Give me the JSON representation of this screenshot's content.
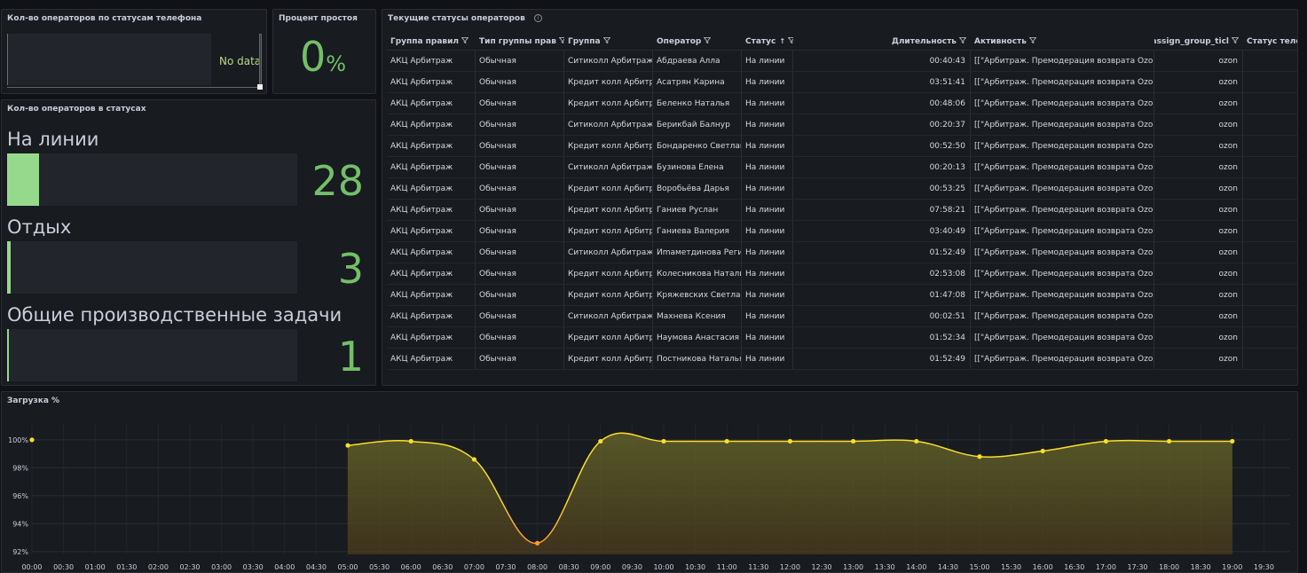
{
  "panels": {
    "phone": {
      "title": "Кол-во операторов по статусам телефона",
      "no_data": "No data"
    },
    "idle": {
      "title": "Процент простоя",
      "value": "0",
      "unit": "%"
    },
    "statuses": {
      "title": "Кол-во операторов в статусах",
      "items": [
        {
          "label": "На линии",
          "value": "28",
          "fill": 0.11
        },
        {
          "label": "Отдых",
          "value": "3",
          "fill": 0.012
        },
        {
          "label": "Общие производственные задачи",
          "value": "1",
          "fill": 0.004
        }
      ]
    },
    "table": {
      "title": "Текущие статусы операторов",
      "columns": [
        "Группа правил",
        "Тип группы прав",
        "Группа",
        "Оператор",
        "Статус",
        "Длительность",
        "Активность",
        "assign_group_ticl",
        "Статус теле"
      ],
      "rows": [
        [
          "АКЦ Арбитраж",
          "Обычная",
          "Ситиколл Арбитраж",
          "Абдраева Алла",
          "На линии",
          "00:40:43",
          "[[\"Арбитраж. Премодерация возврата Ozon",
          "ozon",
          ""
        ],
        [
          "АКЦ Арбитраж",
          "Обычная",
          "Кредит колл Арбитраж",
          "Асатрян Карина",
          "На линии",
          "03:51:41",
          "[[\"Арбитраж. Премодерация возврата Ozon",
          "ozon",
          ""
        ],
        [
          "АКЦ Арбитраж",
          "Обычная",
          "Кредит колл Арбитраж",
          "Беленко Наталья",
          "На линии",
          "00:48:06",
          "[[\"Арбитраж. Премодерация возврата Ozon",
          "ozon",
          ""
        ],
        [
          "АКЦ Арбитраж",
          "Обычная",
          "Ситиколл Арбитраж",
          "Берикбай Балнур",
          "На линии",
          "00:20:37",
          "[[\"Арбитраж. Премодерация возврата Ozon",
          "ozon",
          ""
        ],
        [
          "АКЦ Арбитраж",
          "Обычная",
          "Кредит колл Арбитраж",
          "Бондаренко Светлана",
          "На линии",
          "00:52:50",
          "[[\"Арбитраж. Премодерация возврата Ozon",
          "ozon",
          ""
        ],
        [
          "АКЦ Арбитраж",
          "Обычная",
          "Ситиколл Арбитраж",
          "Бузинова Елена",
          "На линии",
          "00:20:13",
          "[[\"Арбитраж. Премодерация возврата Ozon",
          "ozon",
          ""
        ],
        [
          "АКЦ Арбитраж",
          "Обычная",
          "Кредит колл Арбитраж",
          "Воробьёва Дарья",
          "На линии",
          "00:53:25",
          "[[\"Арбитраж. Премодерация возврата Ozon",
          "ozon",
          ""
        ],
        [
          "АКЦ Арбитраж",
          "Обычная",
          "Кредит колл Арбитраж",
          "Ганиев Руслан",
          "На линии",
          "07:58:21",
          "[[\"Арбитраж. Премодерация возврата Ozon",
          "ozon",
          ""
        ],
        [
          "АКЦ Арбитраж",
          "Обычная",
          "Кредит колл Арбитраж",
          "Ганиева Валерия",
          "На линии",
          "03:40:49",
          "[[\"Арбитраж. Премодерация возврата Ozon",
          "ozon",
          ""
        ],
        [
          "АКЦ Арбитраж",
          "Обычная",
          "Ситиколл Арбитраж",
          "Иmаметдинова Регина",
          "На линии",
          "01:52:49",
          "[[\"Арбитраж. Премодерация возврата Ozon",
          "ozon",
          ""
        ],
        [
          "АКЦ Арбитраж",
          "Обычная",
          "Кредит колл Арбитраж",
          "Колесникова Наталья",
          "На линии",
          "02:53:08",
          "[[\"Арбитраж. Премодерация возврата Ozon",
          "ozon",
          ""
        ],
        [
          "АКЦ Арбитраж",
          "Обычная",
          "Кредит колл Арбитраж",
          "Кряжевских Светлана",
          "На линии",
          "01:47:08",
          "[[\"Арбитраж. Премодерация возврата Ozon",
          "ozon",
          ""
        ],
        [
          "АКЦ Арбитраж",
          "Обычная",
          "Ситиколл Арбитраж",
          "Махнева Ксения",
          "На линии",
          "00:02:51",
          "[[\"Арбитраж. Премодерация возврата Ozon",
          "ozon",
          ""
        ],
        [
          "АКЦ Арбитраж",
          "Обычная",
          "Кредит колл Арбитраж",
          "Наумова Анастасия",
          "На линии",
          "01:52:34",
          "[[\"Арбитраж. Премодерация возврата Ozon",
          "ozon",
          ""
        ],
        [
          "АКЦ Арбитраж",
          "Обычная",
          "Кредит колл Арбитраж",
          "Постникова Наталья",
          "На линии",
          "01:52:49",
          "[[\"Арбитраж. Премодерация возврата Ozon",
          "ozon",
          ""
        ]
      ]
    },
    "load": {
      "title": "Загрузка %"
    }
  },
  "colors": {
    "green": "#73bf69",
    "line": "#fade2a",
    "low": "#ff9830"
  },
  "chart_data": {
    "type": "area",
    "title": "Загрузка %",
    "x_ticks": [
      "00:00",
      "00:30",
      "01:00",
      "01:30",
      "02:00",
      "02:30",
      "03:00",
      "03:30",
      "04:00",
      "04:30",
      "05:00",
      "05:30",
      "06:00",
      "06:30",
      "07:00",
      "07:30",
      "08:00",
      "08:30",
      "09:00",
      "09:30",
      "10:00",
      "10:30",
      "11:00",
      "11:30",
      "12:00",
      "12:30",
      "13:00",
      "13:30",
      "14:00",
      "14:30",
      "15:00",
      "15:30",
      "16:00",
      "16:30",
      "17:00",
      "17:30",
      "18:00",
      "18:30",
      "19:00",
      "19:30"
    ],
    "y_ticks": [
      "100%",
      "98%",
      "96%",
      "94%",
      "92%"
    ],
    "ylim": [
      91.8,
      100.5
    ],
    "series": [
      {
        "points": [
          {
            "x": "00:00",
            "y": 100
          },
          {
            "x": "05:00",
            "y": 99.6
          },
          {
            "x": "06:00",
            "y": 99.9
          },
          {
            "x": "07:00",
            "y": 98.6
          },
          {
            "x": "08:00",
            "y": 92.6
          },
          {
            "x": "09:00",
            "y": 99.9
          },
          {
            "x": "10:00",
            "y": 99.9
          },
          {
            "x": "11:00",
            "y": 99.9
          },
          {
            "x": "12:00",
            "y": 99.9
          },
          {
            "x": "13:00",
            "y": 99.9
          },
          {
            "x": "14:00",
            "y": 99.9
          },
          {
            "x": "15:00",
            "y": 98.8
          },
          {
            "x": "16:00",
            "y": 99.2
          },
          {
            "x": "17:00",
            "y": 99.9
          },
          {
            "x": "18:00",
            "y": 99.9
          },
          {
            "x": "19:00",
            "y": 99.9
          }
        ]
      }
    ]
  }
}
